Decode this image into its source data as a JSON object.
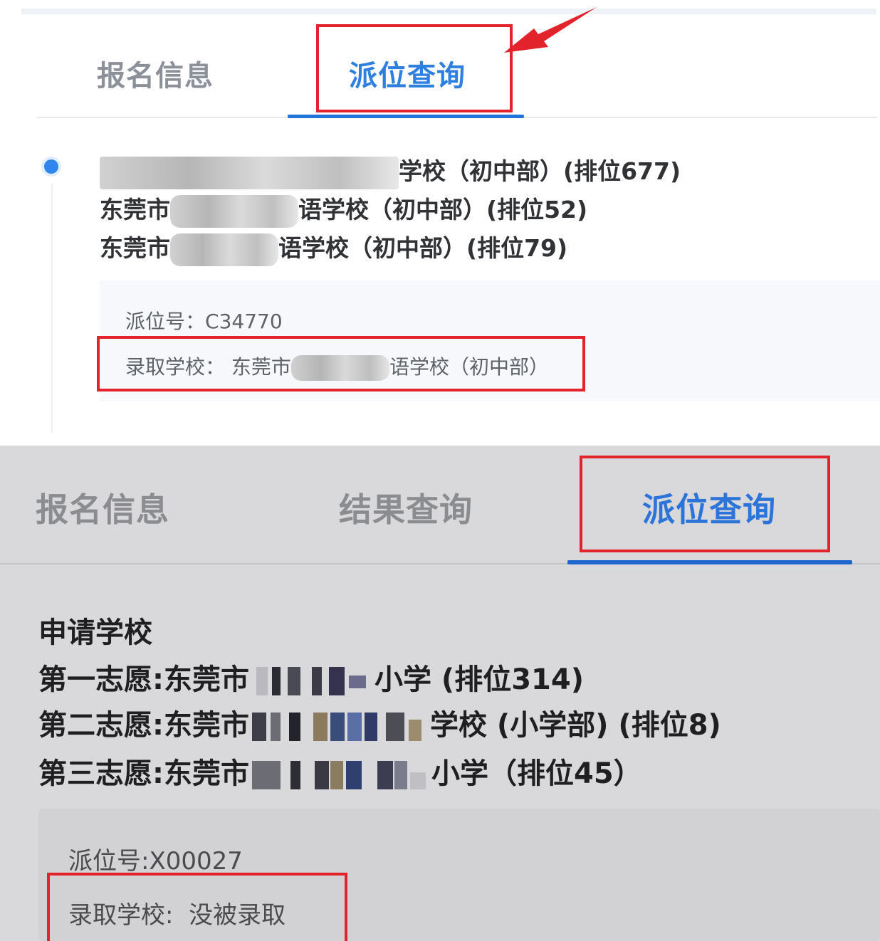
{
  "top_panel": {
    "tabs": [
      {
        "label": "报名信息",
        "active": false
      },
      {
        "label": "派位查询",
        "active": true
      }
    ],
    "choices": [
      {
        "prefix": "",
        "suffix": "学校（初中部）(排位677)"
      },
      {
        "prefix": "东莞市",
        "suffix": "语学校（初中部）(排位52)"
      },
      {
        "prefix": "东莞市",
        "suffix": "语学校（初中部）(排位79)"
      }
    ],
    "result": {
      "number_label": "派位号：",
      "number_value": "C34770",
      "school_label": "录取学校：",
      "school_prefix": "东莞市",
      "school_suffix": "语学校（初中部）"
    }
  },
  "bottom_panel": {
    "tabs": [
      {
        "label": "报名信息",
        "active": false
      },
      {
        "label": "结果查询",
        "active": false
      },
      {
        "label": "派位查询",
        "active": true
      }
    ],
    "section_title": "申请学校",
    "choices": [
      {
        "prefix": "第一志愿:东莞市",
        "suffix": "小学 (排位314)"
      },
      {
        "prefix": "第二志愿:东莞市",
        "suffix": "学校 (小学部) (排位8)"
      },
      {
        "prefix": "第三志愿:东莞市",
        "suffix": "小学（排位45）"
      }
    ],
    "result": {
      "number_label": "派位号:",
      "number_value": "X00027",
      "school_label": "录取学校:",
      "school_value": "没被录取"
    }
  },
  "colors": {
    "accent_blue": "#2d7fe0",
    "highlight_red": "#e3232c"
  }
}
